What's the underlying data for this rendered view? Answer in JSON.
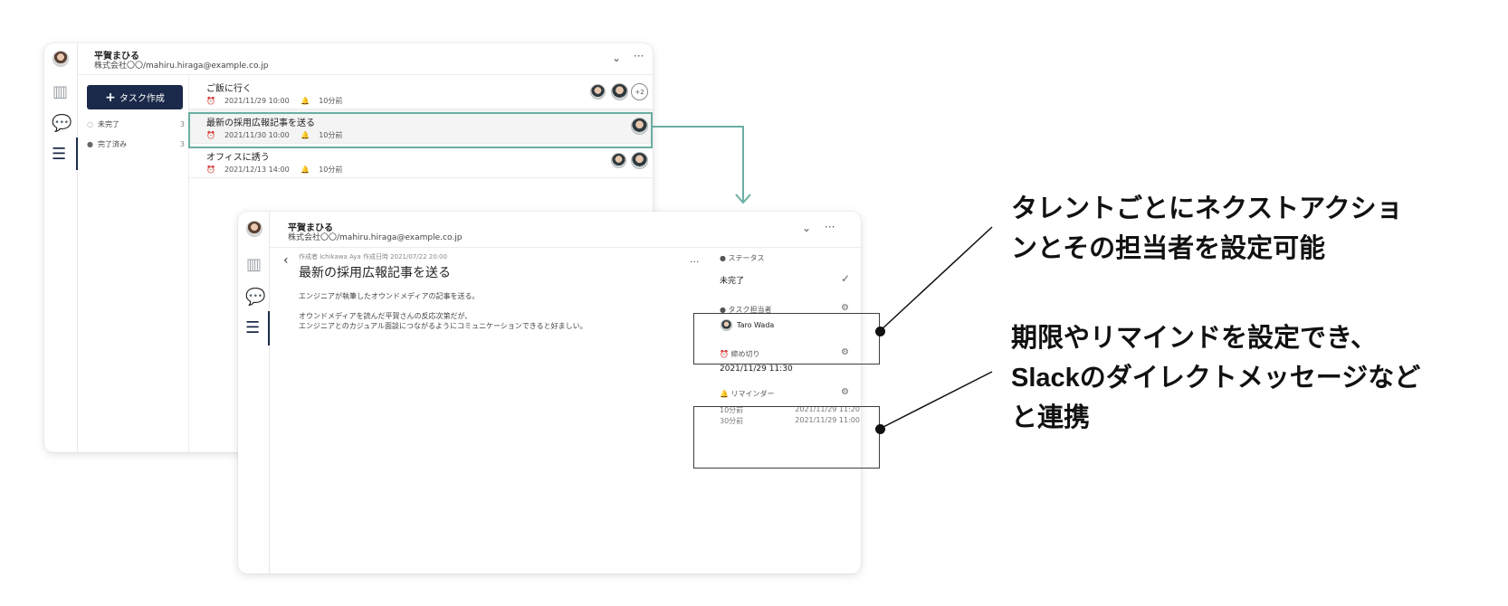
{
  "back_window": {
    "user_name": "平賀まひる",
    "user_sub": "株式会社〇〇/mahiru.hiraga@example.co.jp",
    "create_button": "タスク作成",
    "filters": [
      {
        "label": "未完了",
        "count": "3"
      },
      {
        "label": "完了済み",
        "count": "3"
      }
    ],
    "tasks": [
      {
        "title": "ご飯に行く",
        "date": "2021/11/29 10:00",
        "reminder": "10分前",
        "extra_assignees": "+2"
      },
      {
        "title": "最新の採用広報記事を送る",
        "date": "2021/11/30 10:00",
        "reminder": "10分前"
      },
      {
        "title": "オフィスに誘う",
        "date": "2021/12/13 14:00",
        "reminder": "10分前"
      }
    ]
  },
  "front_window": {
    "user_name": "平賀まひる",
    "user_sub": "株式会社〇〇/mahiru.hiraga@example.co.jp",
    "meta": "作成者 Ichikawa Aya   作成日時 2021/07/22 20:00",
    "title": "最新の採用広報記事を送る",
    "body_lines": [
      "エンジニアが執筆したオウンドメディアの記事を送る。",
      "オウンドメディアを読んだ平賀さんの反応次第だが、",
      "エンジニアとのカジュアル面談につながるようにコミュニケーションできると好ましい。"
    ],
    "status_label": "ステータス",
    "status_value": "未完了",
    "assignee_label": "タスク担当者",
    "assignee_name": "Taro Wada",
    "deadline_label": "締め切り",
    "deadline_value": "2021/11/29 11:30",
    "reminder_label": "リマインダー",
    "reminders": [
      {
        "offset": "10分前",
        "time": "2021/11/29 11:20"
      },
      {
        "offset": "30分前",
        "time": "2021/11/29 11:00"
      }
    ]
  },
  "annotations": {
    "first": [
      "タレントごとにネクストアクショ",
      "ンとその担当者を設定可能"
    ],
    "second": [
      "期限やリマインドを設定でき、",
      "Slackのダイレクトメッセージなど",
      "と連携"
    ]
  },
  "icons": {
    "accent": "#6aaea3",
    "nav": [
      "board-icon",
      "chat-icon",
      "task-list-icon"
    ]
  }
}
